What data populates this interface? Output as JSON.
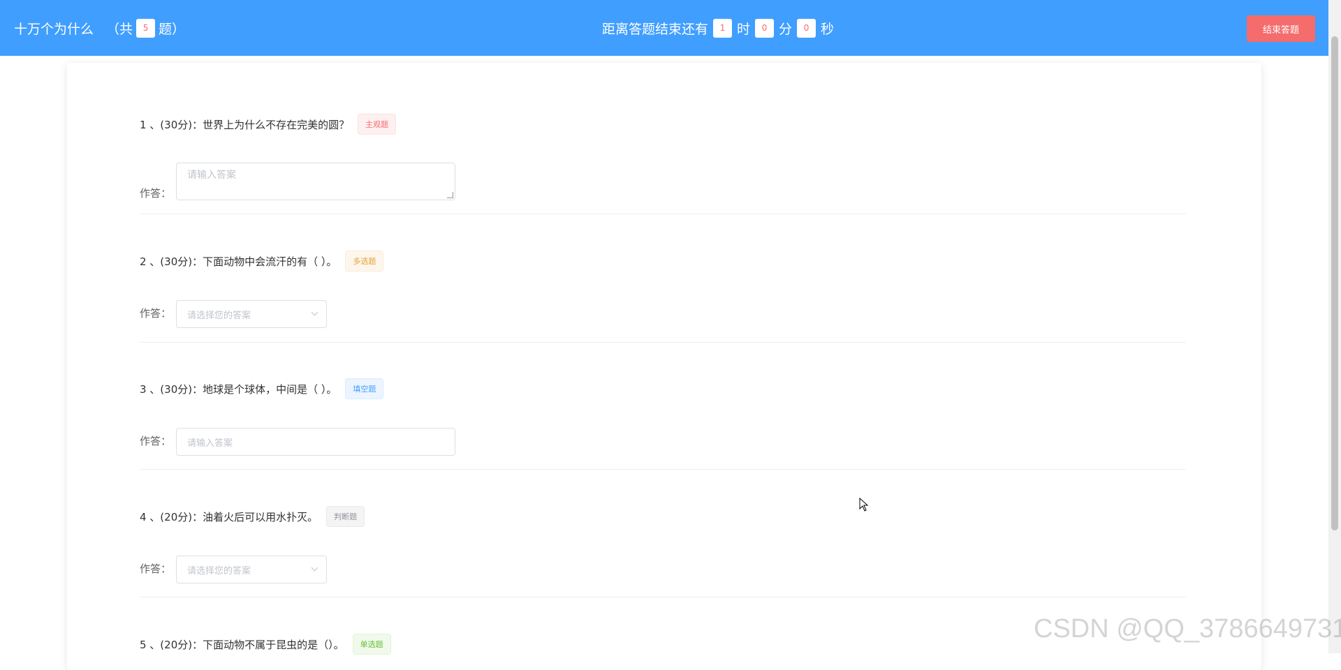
{
  "header": {
    "title": "十万个为什么",
    "count_prefix": "（共",
    "count": "5",
    "count_suffix": "题）",
    "timer_prefix": "距离答题结束还有",
    "hours": "1",
    "hours_unit": "时",
    "minutes": "0",
    "minutes_unit": "分",
    "seconds": "0",
    "seconds_unit": "秒",
    "end_button": "结束答题"
  },
  "answer_label": "作答：",
  "questions": [
    {
      "title": "1 、(30分)：世界上为什么不存在完美的圆？",
      "tag": "主观题",
      "tag_type": "danger",
      "input_type": "textarea",
      "placeholder": "请输入答案"
    },
    {
      "title": "2 、(30分)：下面动物中会流汗的有（ ）。",
      "tag": "多选题",
      "tag_type": "warning",
      "input_type": "select",
      "placeholder": "请选择您的答案"
    },
    {
      "title": "3 、(30分)：地球是个球体，中间是（ ）。",
      "tag": "填空题",
      "tag_type": "primary",
      "input_type": "input",
      "placeholder": "请输入答案"
    },
    {
      "title": "4 、(20分)：油着火后可以用水扑灭。",
      "tag": "判断题",
      "tag_type": "info",
      "input_type": "select",
      "placeholder": "请选择您的答案"
    },
    {
      "title": "5 、(20分)：下面动物不属于昆虫的是（）。",
      "tag": "单选题",
      "tag_type": "success"
    }
  ],
  "watermark": "CSDN @QQ_3786649731",
  "colors": {
    "primary": "#409eff",
    "danger": "#f56c6c"
  }
}
